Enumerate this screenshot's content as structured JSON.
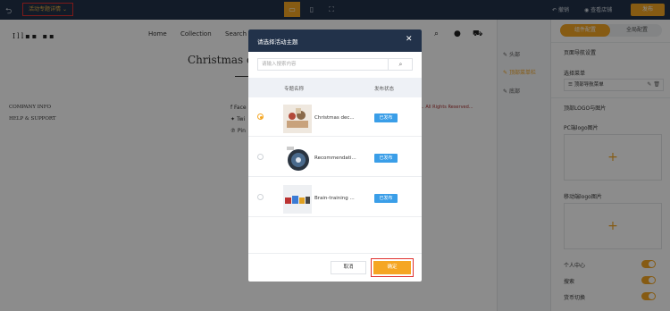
{
  "topbar": {
    "template_select": "活动专题详情",
    "undo": "撤销",
    "help": "查看店铺",
    "publish": "发布"
  },
  "preview": {
    "logo": "Ill▪▪ ▪▪",
    "nav": [
      "Home",
      "Collection",
      "Search"
    ],
    "title": "Christmas d",
    "footer": [
      "COMPANY INFO",
      "HELP & SUPPORT"
    ],
    "social": [
      "Face",
      "Twi",
      "Pin"
    ],
    "rights": "... All Rights Reserved..."
  },
  "sidebar": {
    "rail": [
      "头部",
      "顶部菜单栏",
      "底部"
    ],
    "tabs": [
      "组件配置",
      "全局配置"
    ],
    "section_title": "页面导航设置",
    "menu_label": "选择菜单",
    "menu_value": "顶部导航菜单",
    "logo_section": "顶部LOGO与图片",
    "pc_logo": "PC端logo图片",
    "mobile_logo": "移动端logo图片",
    "toggles": [
      "个人中心",
      "搜索",
      "货币切换"
    ]
  },
  "modal": {
    "title": "请选择活动主题",
    "search_placeholder": "请输入搜索内容",
    "col_name": "专题名称",
    "col_status": "发布状态",
    "rows": [
      {
        "name": "Christmas dec...",
        "status": "已发布",
        "selected": true
      },
      {
        "name": "Recommendati...",
        "status": "已发布",
        "selected": false
      },
      {
        "name": "Brain-training ...",
        "status": "已发布",
        "selected": false
      }
    ],
    "cancel": "取消",
    "confirm": "确定"
  }
}
